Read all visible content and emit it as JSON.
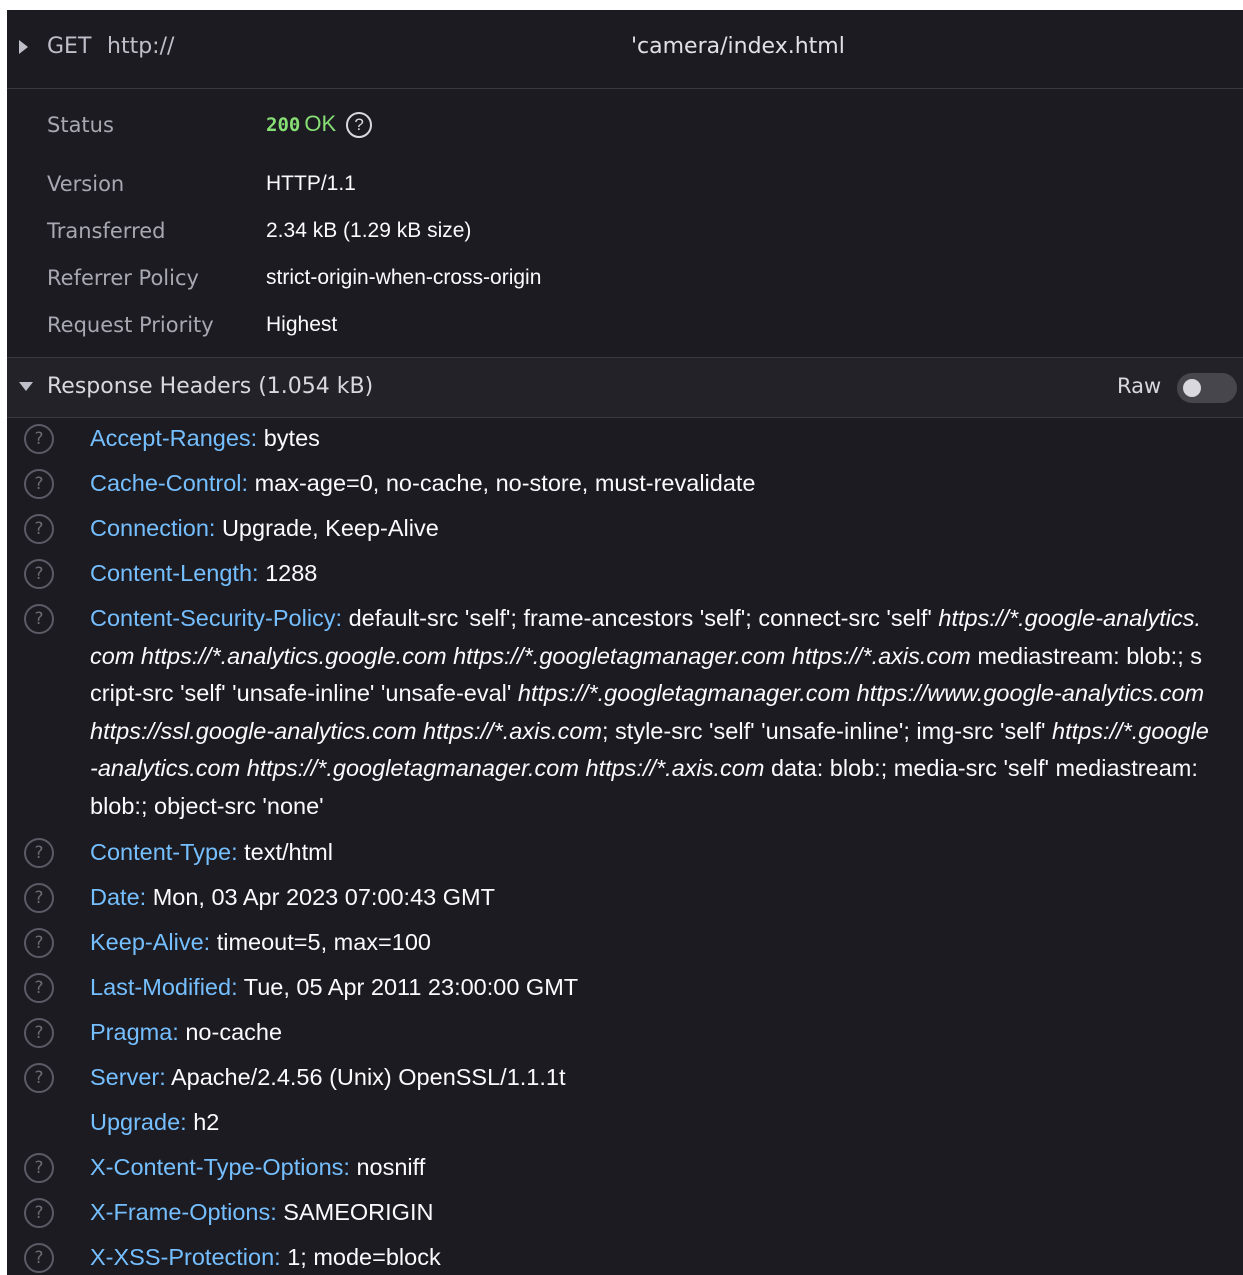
{
  "request": {
    "method": "GET",
    "url_prefix": "http://",
    "url_path": "'camera/index.html"
  },
  "summary": {
    "status_label": "Status",
    "status_code": "200",
    "status_text": "OK",
    "status_help": "?",
    "version_label": "Version",
    "version_value": "HTTP/1.1",
    "transferred_label": "Transferred",
    "transferred_value": "2.34 kB (1.29 kB size)",
    "referrer_label": "Referrer Policy",
    "referrer_value": "strict-origin-when-cross-origin",
    "priority_label": "Request Priority",
    "priority_value": "Highest"
  },
  "response_headers": {
    "title": "Response Headers (1.054 kB)",
    "raw_label": "Raw",
    "raw_enabled": false,
    "items": [
      {
        "name": "Accept-Ranges:",
        "value": "bytes",
        "help": true
      },
      {
        "name": "Cache-Control:",
        "value": "max-age=0, no-cache, no-store, must-revalidate",
        "help": true
      },
      {
        "name": "Connection:",
        "value": "Upgrade, Keep-Alive",
        "help": true
      },
      {
        "name": "Content-Length:",
        "value": "1288",
        "help": true
      },
      {
        "name": "Content-Security-Policy:",
        "help": true,
        "csp": {
          "v1": "default-src 'self'; frame-ancestors 'self'; connect-src 'self' ",
          "u1": "https://*.google-analytics.com https://*.analytics.google.com https://*.googletagmanager.com https://*.axis.com",
          "v2": " mediastream: blob:; script-src 'self' 'unsafe-inline' 'unsafe-eval' ",
          "u2": "https://*.googletagmanager.com https://www.google-analytics.com https://ssl.google-analytics.com https://*.axis.com",
          "v3": "; style-src 'self' 'unsafe-inline'; img-src 'self' ",
          "u3": "https://*.google-analytics.com https://*.googletagmanager.com https://*.axis.com",
          "v4": " data: blob:; media-src 'self' mediastream: blob:; object-src 'none'"
        }
      },
      {
        "name": "Content-Type:",
        "value": "text/html",
        "help": true
      },
      {
        "name": "Date:",
        "value": "Mon, 03 Apr 2023 07:00:43 GMT",
        "help": true
      },
      {
        "name": "Keep-Alive:",
        "value": "timeout=5, max=100",
        "help": true
      },
      {
        "name": "Last-Modified:",
        "value": "Tue, 05 Apr 2011 23:00:00 GMT",
        "help": true
      },
      {
        "name": "Pragma:",
        "value": "no-cache",
        "help": true
      },
      {
        "name": "Server:",
        "value": "Apache/2.4.56 (Unix) OpenSSL/1.1.1t",
        "help": true
      },
      {
        "name": "Upgrade:",
        "value": "h2",
        "help": false
      },
      {
        "name": "X-Content-Type-Options:",
        "value": "nosniff",
        "help": true
      },
      {
        "name": "X-Frame-Options:",
        "value": "SAMEORIGIN",
        "help": true
      },
      {
        "name": "X-XSS-Protection:",
        "value": "1; mode=block",
        "help": true
      }
    ]
  },
  "icons": {
    "help": "question-circle-icon",
    "collapse": "triangle-right-icon",
    "expand": "triangle-down-icon"
  },
  "colors": {
    "background": "#1c1b22",
    "header_name": "#75bfff",
    "status_ok": "#86de74",
    "text": "#fbfbfe"
  }
}
